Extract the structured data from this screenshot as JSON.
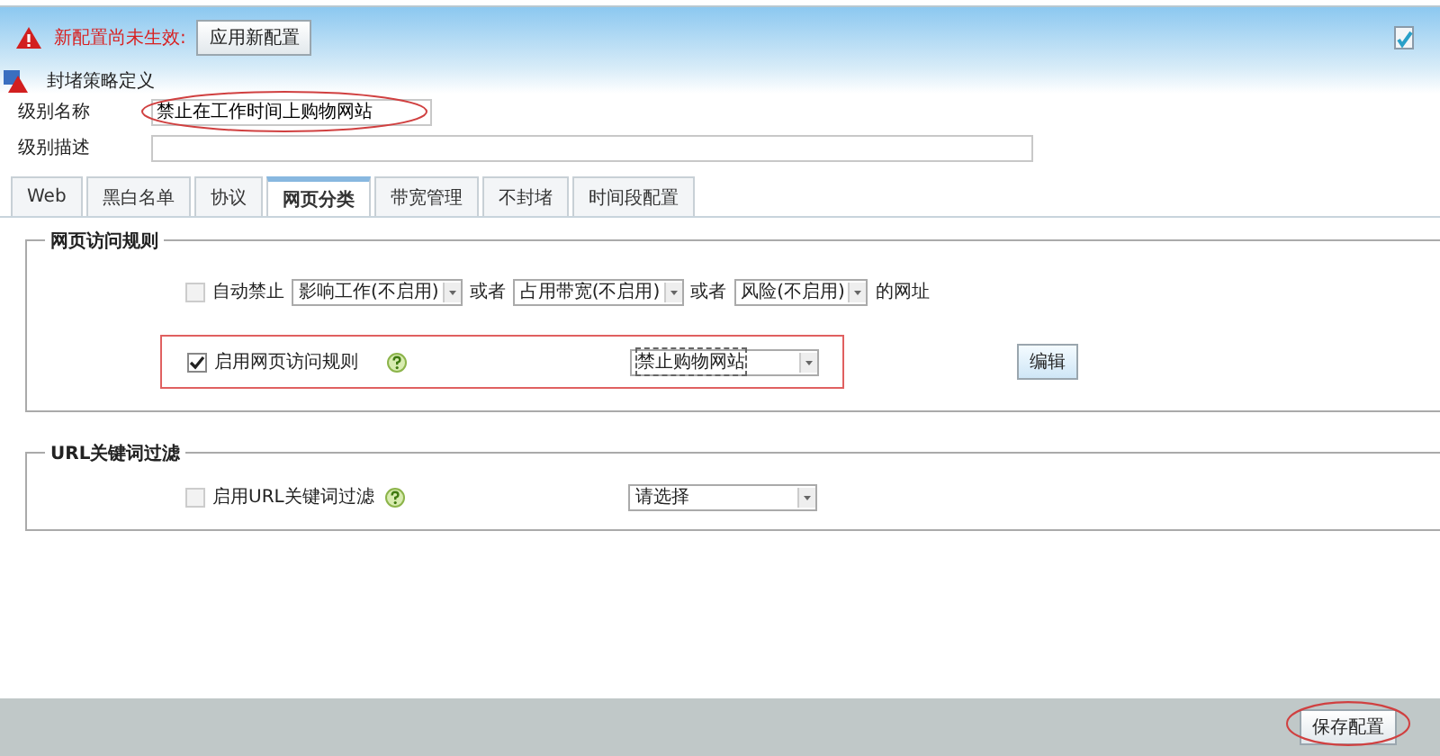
{
  "notice": {
    "message": "新配置尚未生效:",
    "button": "应用新配置"
  },
  "page_title": "封堵策略定义",
  "fields": [
    {
      "label": "级别名称",
      "value": "禁止在工作时间上购物网站",
      "highlighted": true
    },
    {
      "label": "级别描述",
      "highlighted": false
    }
  ],
  "tabs": [
    {
      "label": "Web",
      "selected": false
    },
    {
      "label": "黑白名单",
      "selected": false
    },
    {
      "label": "协议",
      "selected": false
    },
    {
      "label": "网页分类",
      "selected": true
    },
    {
      "label": "带宽管理",
      "selected": false
    },
    {
      "label": "不封堵",
      "selected": false
    },
    {
      "label": "时间段配置",
      "selected": false
    }
  ],
  "sections": [
    {
      "title": "网页访问规则",
      "rows": [
        {
          "kind": "auto",
          "checked": false,
          "disabled": true,
          "label": "自动禁止",
          "parts": [
            {
              "kind": "select",
              "value": "影响工作(不启用)"
            },
            {
              "kind": "text",
              "text": "或者"
            },
            {
              "kind": "select",
              "value": "占用带宽(不启用)"
            },
            {
              "kind": "text",
              "text": "或者"
            },
            {
              "kind": "select",
              "value": "风险(不启用)"
            },
            {
              "kind": "text",
              "text": "的网址"
            }
          ]
        },
        {
          "kind": "rule",
          "checked": true,
          "disabled": false,
          "highlighted": true,
          "label": "启用网页访问规则",
          "select": "禁止购物网站",
          "button": "编辑"
        }
      ]
    },
    {
      "title": "URL关键词过滤",
      "rows": [
        {
          "kind": "rule",
          "checked": false,
          "disabled": true,
          "highlighted": false,
          "label": "启用URL关键词过滤",
          "select": "请选择"
        }
      ]
    }
  ],
  "save_button": {
    "label": "保存配置",
    "highlighted": true
  }
}
